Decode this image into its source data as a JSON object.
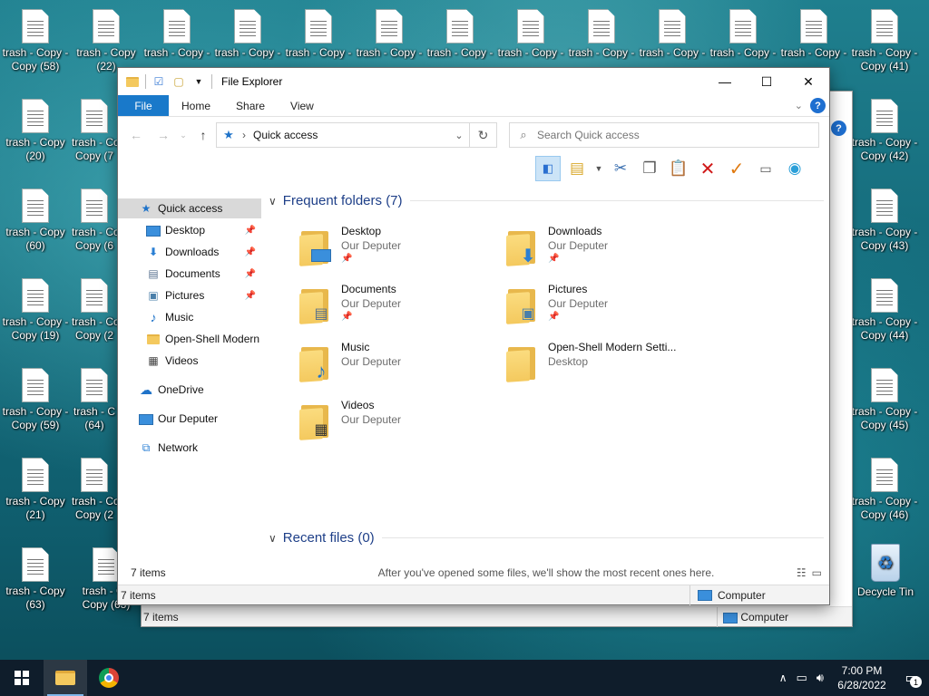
{
  "desktop": {
    "icons": [
      {
        "l1": "trash - Copy -",
        "l2": "Copy (58)"
      },
      {
        "l1": "trash - Copy",
        "l2": "(22)"
      },
      {
        "l1": "trash - Copy -",
        "l2": ""
      },
      {
        "l1": "trash - Copy -",
        "l2": ""
      },
      {
        "l1": "trash - Copy -",
        "l2": ""
      },
      {
        "l1": "trash - Copy -",
        "l2": ""
      },
      {
        "l1": "trash - Copy -",
        "l2": ""
      },
      {
        "l1": "trash - Copy -",
        "l2": ""
      },
      {
        "l1": "trash - Copy -",
        "l2": ""
      },
      {
        "l1": "trash - Copy -",
        "l2": ""
      },
      {
        "l1": "trash - Copy -",
        "l2": ""
      },
      {
        "l1": "trash - Copy -",
        "l2": ""
      },
      {
        "l1": "trash - Copy -",
        "l2": "Copy (41)"
      },
      {
        "l1": "trash - Copy",
        "l2": "(20)"
      },
      {
        "l1": "trash - Co",
        "l2": "Copy (7"
      },
      {
        "l1": "trash - Copy -",
        "l2": "Copy (42)"
      },
      {
        "l1": "trash - Copy",
        "l2": "(60)"
      },
      {
        "l1": "trash - Co",
        "l2": "Copy (6"
      },
      {
        "l1": "trash - Copy -",
        "l2": "Copy (43)"
      },
      {
        "l1": "trash - Copy -",
        "l2": "Copy (19)"
      },
      {
        "l1": "trash - Co",
        "l2": "Copy (2"
      },
      {
        "l1": "trash - Copy -",
        "l2": "Copy (44)"
      },
      {
        "l1": "trash - Copy -",
        "l2": "Copy (59)"
      },
      {
        "l1": "trash - C",
        "l2": "(64)"
      },
      {
        "l1": "trash - Copy -",
        "l2": "Copy (45)"
      },
      {
        "l1": "trash - Copy",
        "l2": "(21)"
      },
      {
        "l1": "trash - Co",
        "l2": "Copy (2"
      },
      {
        "l1": "trash - Copy -",
        "l2": "Copy (46)"
      },
      {
        "l1": "trash - Copy",
        "l2": "(63)"
      },
      {
        "l1": "trash - Co",
        "l2": "Copy (63)"
      }
    ],
    "recycle_label": "Decycle Tin"
  },
  "bg_windows": {
    "status_items": "7 items",
    "status_computer": "Computer",
    "status_items_2": "7 items",
    "status_computer_2": "Computer"
  },
  "window": {
    "title": "File Explorer",
    "tabs": {
      "file": "File",
      "home": "Home",
      "share": "Share",
      "view": "View"
    },
    "address": {
      "crumb": "Quick access"
    },
    "search": {
      "placeholder": "Search Quick access"
    },
    "nav": {
      "quick_access": "Quick access",
      "desktop": "Desktop",
      "downloads": "Downloads",
      "documents": "Documents",
      "pictures": "Pictures",
      "music": "Music",
      "openshell": "Open-Shell Modern",
      "videos": "Videos",
      "onedrive": "OneDrive",
      "this_pc": "Our Deputer",
      "network": "Network"
    },
    "frequent": {
      "header": "Frequent folders (7)",
      "items": [
        {
          "name": "Desktop",
          "sub": "Our Deputer"
        },
        {
          "name": "Downloads",
          "sub": "Our Deputer"
        },
        {
          "name": "Documents",
          "sub": "Our Deputer"
        },
        {
          "name": "Pictures",
          "sub": "Our Deputer"
        },
        {
          "name": "Music",
          "sub": "Our Deputer"
        },
        {
          "name": "Open-Shell Modern Setti...",
          "sub": "Desktop"
        },
        {
          "name": "Videos",
          "sub": "Our Deputer"
        }
      ]
    },
    "recent": {
      "header": "Recent files (0)",
      "empty": "After you've opened some files, we'll show the most recent ones here."
    },
    "status": {
      "items": "7 items"
    },
    "status2": {
      "items": "7 items",
      "computer": "Computer"
    }
  },
  "taskbar": {
    "time": "7:00 PM",
    "date": "6/28/2022",
    "notifications": "1"
  },
  "colors": {
    "accent": "#1979ca",
    "section_header": "#1e3f88",
    "taskbar": "#0f1d2b"
  }
}
